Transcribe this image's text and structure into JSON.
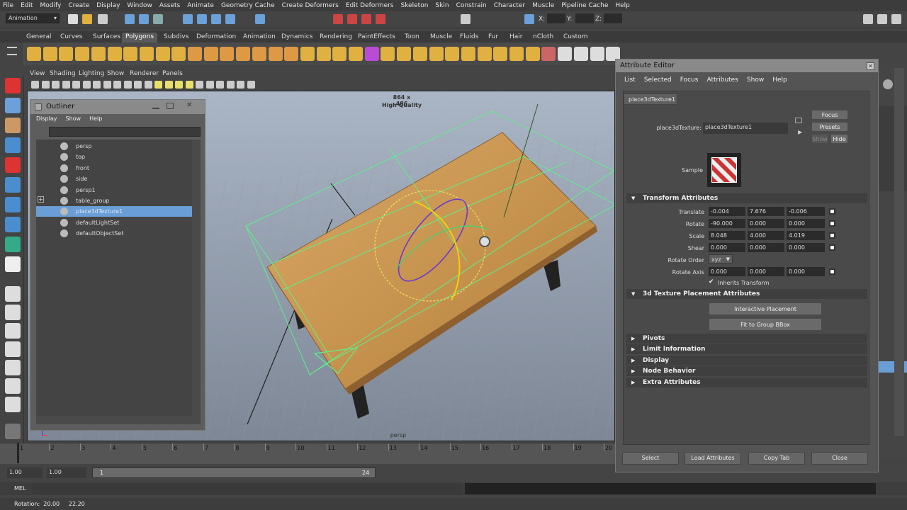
{
  "menubar": [
    "File",
    "Edit",
    "Modify",
    "Create",
    "Display",
    "Window",
    "Assets",
    "Animate",
    "Geometry Cache",
    "Create Deformers",
    "Edit Deformers",
    "Skeleton",
    "Skin",
    "Constrain",
    "Character",
    "Muscle",
    "Pipeline Cache",
    "Help"
  ],
  "status": {
    "mode": "Animation",
    "x_label": "X:",
    "y_label": "Y:",
    "z_label": "Z:"
  },
  "shelf_tabs": [
    "General",
    "Curves",
    "Surfaces",
    "Polygons",
    "Subdivs",
    "Deformation",
    "Animation",
    "Dynamics",
    "Rendering",
    "PaintEffects",
    "Toon",
    "Muscle",
    "Fluids",
    "Fur",
    "Hair",
    "nCloth",
    "Custom"
  ],
  "active_shelf": "Polygons",
  "panel_menu": [
    "View",
    "Shading",
    "Lighting",
    "Show",
    "Renderer",
    "Panels"
  ],
  "viewport": {
    "resolution": "864 x 486",
    "quality": "High Quality",
    "camera": "persp"
  },
  "outliner": {
    "title": "Outliner",
    "menu": [
      "Display",
      "Show",
      "Help"
    ],
    "items": [
      "persp",
      "top",
      "front",
      "side",
      "persp1",
      "table_group",
      "place3dTexture1",
      "defaultLightSet",
      "defaultObjectSet"
    ]
  },
  "attr_editor": {
    "title": "Attribute Editor",
    "menu": [
      "List",
      "Selected",
      "Focus",
      "Attributes",
      "Show",
      "Help"
    ],
    "tab": "place3dTexture1",
    "node_label": "place3dTexture:",
    "node_name": "place3dTexture1",
    "focus": "Focus",
    "presets": "Presets",
    "show": "Show",
    "hide": "Hide",
    "sample": "Sample",
    "transform_header": "Transform Attributes",
    "translate_label": "Translate",
    "translate": [
      "-0.004",
      "7.676",
      "-0.006"
    ],
    "rotate_label": "Rotate",
    "rotate": [
      "-90.000",
      "0.000",
      "0.000"
    ],
    "scale_label": "Scale",
    "scale": [
      "8.048",
      "4.000",
      "4.019"
    ],
    "shear_label": "Shear",
    "shear": [
      "0.000",
      "0.000",
      "0.000"
    ],
    "rotate_order_label": "Rotate Order",
    "rotate_order": "xyz",
    "rotate_axis_label": "Rotate Axis",
    "rotate_axis": [
      "0.000",
      "0.000",
      "0.000"
    ],
    "inherits": "Inherits Transform",
    "placement_header": "3d Texture Placement Attributes",
    "interactive": "Interactive Placement",
    "fit": "Fit to Group BBox",
    "collapsed": [
      "Pivots",
      "Limit Information",
      "Display",
      "Node Behavior",
      "Extra Attributes"
    ],
    "bottom": [
      "Select",
      "Load Attributes",
      "Copy Tab",
      "Close"
    ]
  },
  "timeline": {
    "ticks": [
      "1",
      "2",
      "3",
      "4",
      "5",
      "6",
      "7",
      "8",
      "9",
      "10",
      "11",
      "12",
      "13",
      "14",
      "15",
      "16",
      "17",
      "18",
      "19",
      "20"
    ]
  },
  "range": {
    "start": "1.00",
    "start2": "1.00",
    "frame": "1",
    "end": "24"
  },
  "cmd": {
    "label": "MEL"
  },
  "help": {
    "text": "Rotation:  20.00     22.20"
  },
  "colors": {
    "selection": "#6a9ed6",
    "wood": "#c89550",
    "wire": "#5cf08a"
  }
}
